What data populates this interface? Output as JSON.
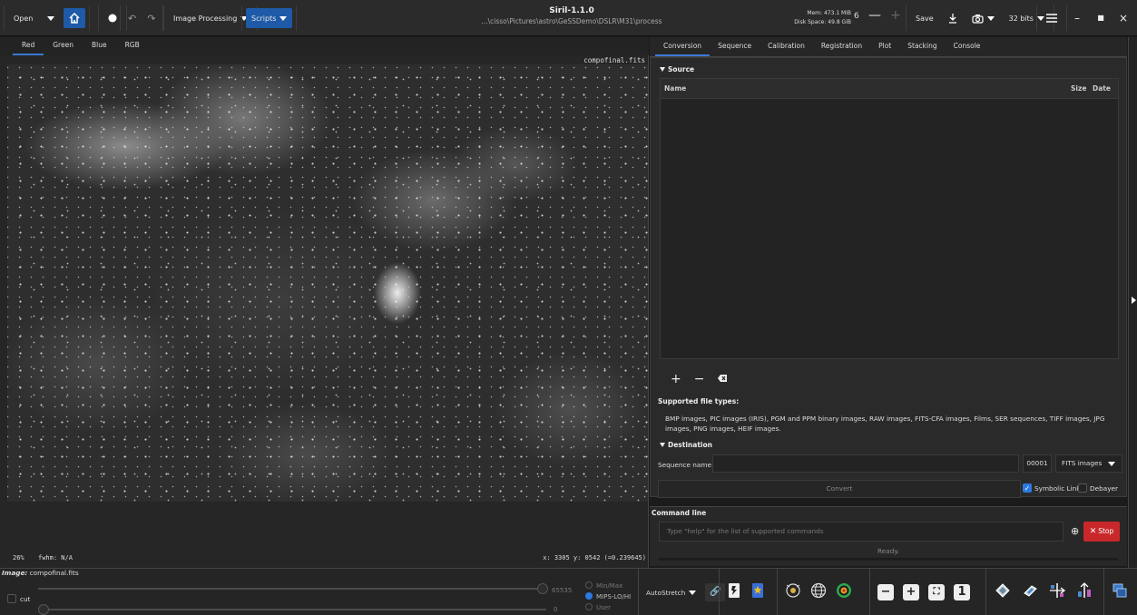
{
  "header": {
    "open_label": "Open",
    "image_processing_label": "Image Processing",
    "scripts_label": "Scripts",
    "app_title": "Siril-1.1.0",
    "path": "...\\cisso\\Pictures\\astro\\GeSSDemo\\DSLR\\M31\\process",
    "mem": "Mem: 473.1 MiB",
    "disk": "Disk Space: 49.8 GiB",
    "thread_count": "6",
    "save_label": "Save",
    "bits_label": "32 bits"
  },
  "channels": [
    "Red",
    "Green",
    "Blue",
    "RGB"
  ],
  "canvas": {
    "filename": "compofinal.fits",
    "zoom": "26%",
    "fwhm": "fwhm: N/A",
    "coords": "x: 3305 y: 0542 (=0.239645)"
  },
  "panel_tabs": [
    "Conversion",
    "Sequence",
    "Calibration",
    "Registration",
    "Plot",
    "Stacking",
    "Console"
  ],
  "conversion": {
    "source_label": "Source",
    "col_name": "Name",
    "col_size": "Size",
    "col_date": "Date",
    "supported_title": "Supported file types:",
    "supported_text": "BMP images, PIC images (IRIS), PGM and PPM binary images, RAW images, FITS-CFA images, Films, SER sequences, TIFF images, JPG images, PNG images, HEIF images.",
    "destination_label": "Destination",
    "sequence_name_label": "Sequence name:",
    "index_value": "00001",
    "format_value": "FITS images",
    "convert_label": "Convert",
    "symbolic_link_label": "Symbolic Link",
    "debayer_label": "Debayer"
  },
  "command": {
    "title": "Command line",
    "placeholder": "Type \"help\" for the list of supported commands",
    "stop_label": "Stop",
    "status": "Ready."
  },
  "bottom": {
    "image_label": "Image:",
    "image_name": "compofinal.fits",
    "cut_label": "cut",
    "high_value": "65535",
    "low_value": "0",
    "radio_minmax": "Min/Max",
    "radio_mips": "MIPS-LO/HI",
    "radio_user": "User",
    "autostretch_label": "AutoStretch",
    "zoom_1": "1"
  }
}
